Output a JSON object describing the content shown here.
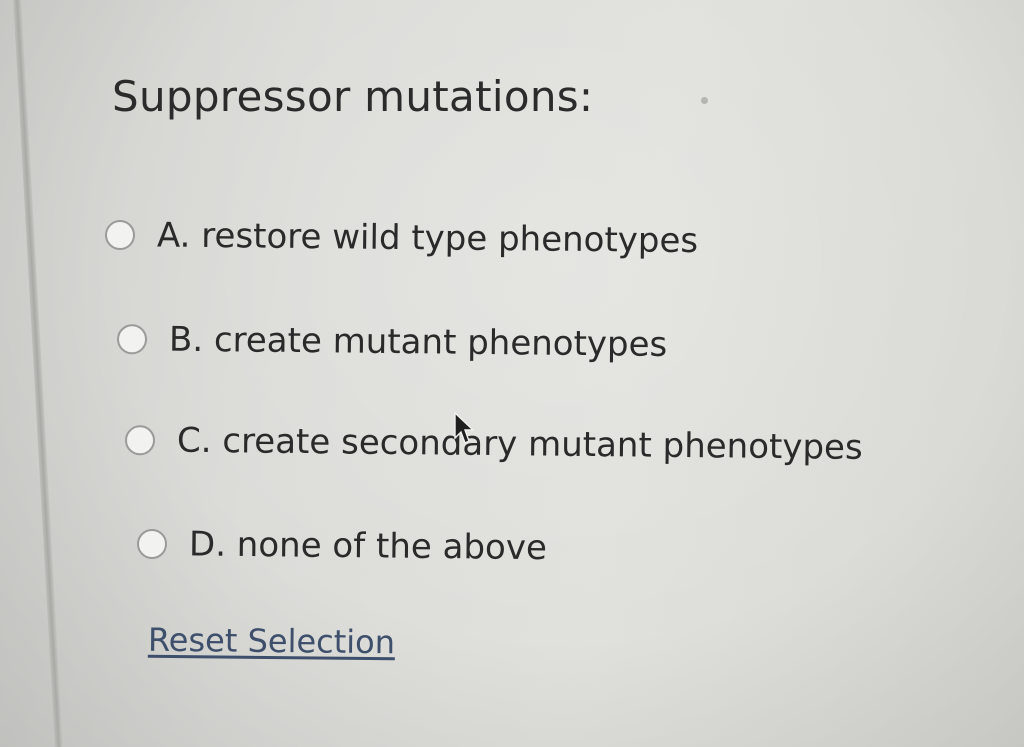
{
  "question": {
    "title": "Suppressor mutations:"
  },
  "choices": [
    {
      "label": "A. restore wild type phenotypes"
    },
    {
      "label": "B. create mutant phenotypes"
    },
    {
      "label": "C. create secondary mutant phenotypes"
    },
    {
      "label": "D. none of the above"
    }
  ],
  "actions": {
    "reset_label": "Reset Selection"
  },
  "icons": {
    "radio": "radio-button-icon",
    "pointer": "mouse-pointer-icon"
  },
  "colors": {
    "link": "#3d4f6b",
    "text": "#2a2a2a",
    "radio_border": "#9a9a98"
  }
}
